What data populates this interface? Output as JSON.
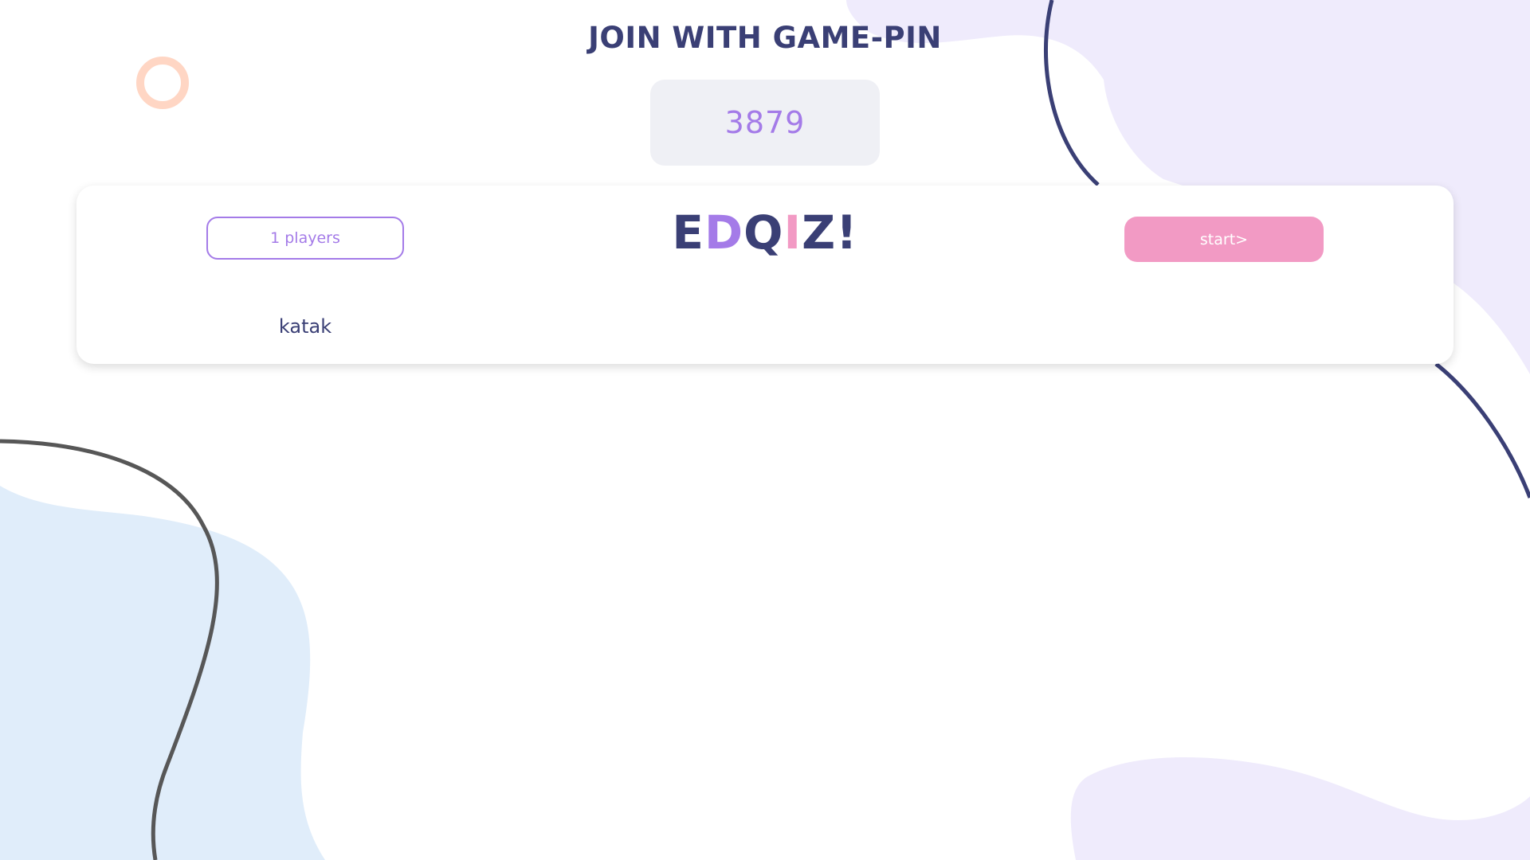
{
  "header": {
    "title": "JOIN WITH GAME-PIN",
    "game_pin": "3879"
  },
  "lobby": {
    "players_count_label": "1 players",
    "start_label": "start>",
    "logo": {
      "letters": [
        {
          "char": "E",
          "color": "#3a3f75"
        },
        {
          "char": "D",
          "color": "#a47be8"
        },
        {
          "char": "Q",
          "color": "#3a3f75"
        },
        {
          "char": "I",
          "color": "#f29ac4"
        },
        {
          "char": "Z",
          "color": "#3a3f75"
        },
        {
          "char": "!",
          "color": "#3a3f75"
        }
      ]
    },
    "players": [
      "katak"
    ]
  },
  "colors": {
    "navy": "#3a3f75",
    "purple": "#a47be8",
    "pink": "#f29ac4",
    "lavender_blob": "#efebfc",
    "blue_blob": "#e0edfa",
    "peach_ring": "#ffd6c4",
    "pin_box": "#eff0f5"
  }
}
